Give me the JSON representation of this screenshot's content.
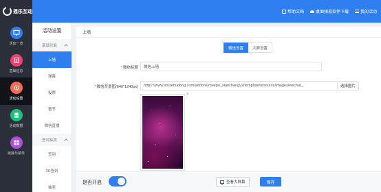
{
  "header": {
    "brand": "摇乐互动",
    "links": [
      {
        "label": "帮助文档",
        "icon": "book-icon"
      },
      {
        "label": "桌面弹幕软件下载",
        "icon": "cloud-download-icon"
      },
      {
        "label": "我的活动",
        "icon": "menu-icon"
      }
    ]
  },
  "iconbar": {
    "items": [
      {
        "label": "活动一览",
        "icon": "monitor-icon",
        "color": "#2f7ff0"
      },
      {
        "label": "基础信息",
        "icon": "info-icon",
        "color": "#f03e6e"
      },
      {
        "label": "活动设置",
        "icon": "gear-icon",
        "color": "#f26b52"
      },
      {
        "label": "活动数据",
        "icon": "database-icon",
        "color": "#1fbf78"
      },
      {
        "label": "链接与菜单",
        "icon": "grid-icon",
        "color": "#b04fd8"
      }
    ]
  },
  "subbar": {
    "title": "活动设置",
    "group1": "基础功能",
    "group1_items": [
      "上墙",
      "弹幕",
      "投票",
      "善节",
      "微信直播"
    ],
    "group2": "签到抽奖",
    "group2_items": [
      "签到",
      "3D签到",
      "抽奖"
    ]
  },
  "main": {
    "breadcrumb": "上墙",
    "tabs": [
      "微信设置",
      "大屏设置"
    ],
    "title_label": "微信标题",
    "title_value": "微信上墙",
    "bg_label": "微信背景图(640*1240px)",
    "bg_url": "https://www.shulehudong.com/addons/meepo_xianchangv2/template/resource/images/wechat_",
    "select_button": "选择图片",
    "remove": "×"
  },
  "footer": {
    "label": "是否开启",
    "view_button": "查看大屏幕",
    "save_button": "保存"
  }
}
